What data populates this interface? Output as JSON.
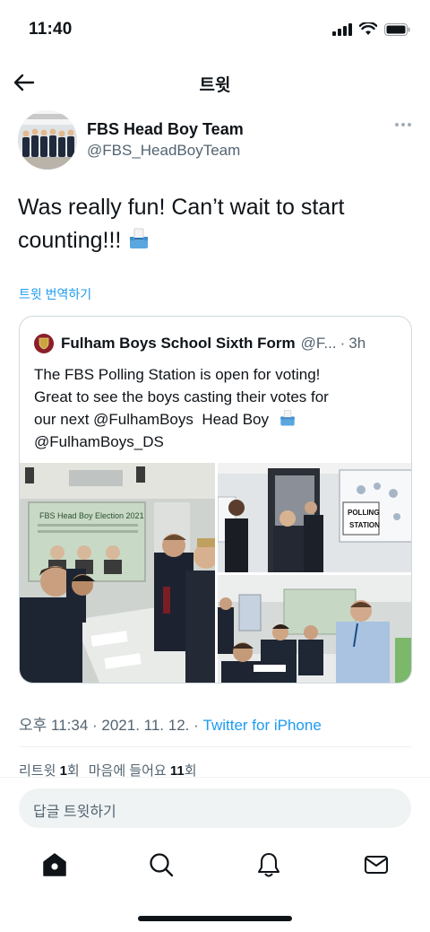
{
  "status_bar": {
    "time": "11:40"
  },
  "nav": {
    "title": "트윗"
  },
  "tweet": {
    "author_name": "FBS Head Boy Team",
    "author_handle": "@FBS_HeadBoyTeam",
    "text": "Was really fun! Can’t wait to start counting!!!",
    "translate_label": "트윗 번역하기",
    "timestamp": "오후 11:34 · 2021. 11. 12. · ",
    "source": "Twitter for iPhone",
    "stats": {
      "retweet_label": "리트윗",
      "retweet_count": "1",
      "retweet_unit": "회",
      "like_label": "마음에 들어요",
      "like_count": "11",
      "like_unit": "회"
    }
  },
  "quoted_tweet": {
    "author_name": "Fulham Boys School Sixth Form",
    "author_handle": "@F...",
    "time": "3h",
    "text_lines": [
      "The FBS Polling Station is open for voting!",
      "Great to see the boys casting their votes for",
      "our next @FulhamBoys  Head Boy",
      "@FulhamBoys_DS"
    ],
    "photos": [
      {
        "screen_title": "FBS Head Boy Election 2021",
        "screen_sub": "Select the candidate by putting a cross (X) in the box next to your choice"
      },
      {
        "sign_text_1": "POLLING",
        "sign_text_2": "STATION"
      },
      {
        "description_label": ""
      }
    ]
  },
  "reply": {
    "placeholder": "답글 트윗하기"
  },
  "tab_bar": {
    "icons": [
      "home-icon",
      "search-icon",
      "notifications-icon",
      "messages-icon"
    ]
  },
  "colors": {
    "accent": "#1d9bf0",
    "text": "#0f1419",
    "secondary": "#536471",
    "border": "#cfd9de"
  }
}
